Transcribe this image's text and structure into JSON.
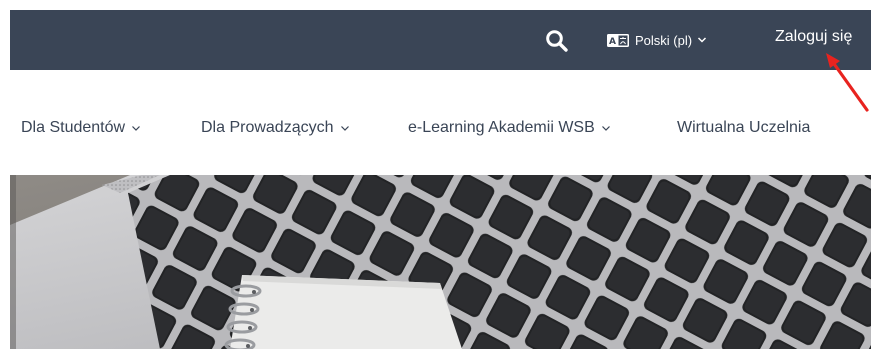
{
  "header": {
    "language": {
      "badge_text": "A",
      "label": "Polski (pl)",
      "chevron_icon": "chevron-down-icon"
    },
    "login_label": "Zaloguj się",
    "search_icon": "search-icon",
    "background_color": "#3a4556"
  },
  "nav": {
    "items": [
      {
        "label": "Dla Studentów",
        "has_dropdown": true
      },
      {
        "label": "Dla Prowadzących",
        "has_dropdown": true
      },
      {
        "label": "e-Learning Akademii WSB",
        "has_dropdown": true
      },
      {
        "label": "Wirtualna Uczelnia",
        "has_dropdown": false
      }
    ],
    "text_color": "#3a4556"
  },
  "hero": {
    "image": "laptop-keyboard-with-spiral-notebook"
  },
  "annotation": {
    "arrow_color": "#e8231f",
    "points_to": "login"
  }
}
